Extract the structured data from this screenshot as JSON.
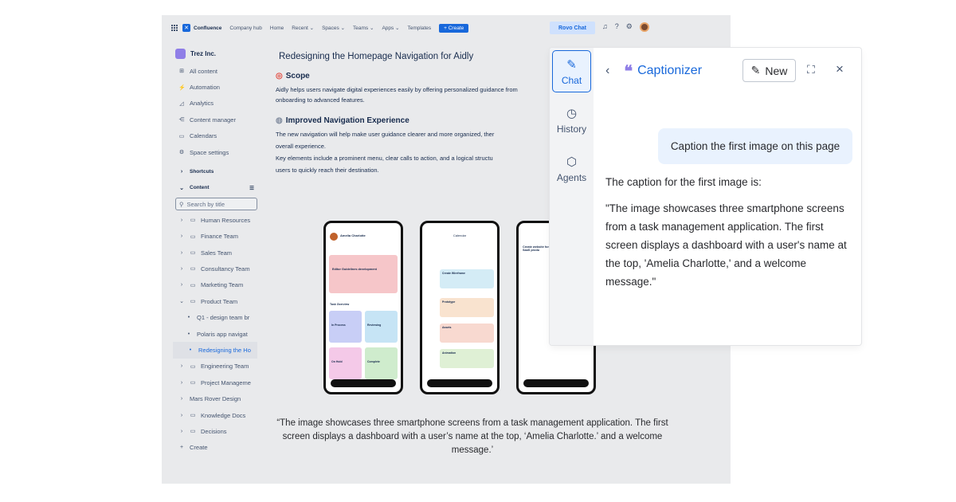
{
  "topbar": {
    "brand": "Confluence",
    "nav": [
      "Company hub",
      "Home",
      "Recent ⌄",
      "Spaces ⌄",
      "Teams ⌄",
      "Apps ⌄",
      "Templates"
    ],
    "create": "+ Create",
    "rovo_chat": "Rovo Chat"
  },
  "sidebar": {
    "space": "Trez Inc.",
    "items": [
      {
        "icon": "⊞",
        "label": "All content"
      },
      {
        "icon": "⚡",
        "label": "Automation"
      },
      {
        "icon": "◿",
        "label": "Analytics"
      },
      {
        "icon": "⋲",
        "label": "Content manager"
      },
      {
        "icon": "▭",
        "label": "Calendars"
      },
      {
        "icon": "⚙",
        "label": "Space settings"
      }
    ],
    "shortcuts": "Shortcuts",
    "content": "Content",
    "search_placeholder": "Search by title",
    "tree": [
      {
        "chev": "›",
        "icon": "▭",
        "label": "Human Resources",
        "indent": 0
      },
      {
        "chev": "›",
        "icon": "▭",
        "label": "Finance Team",
        "indent": 0
      },
      {
        "chev": "›",
        "icon": "▭",
        "label": "Sales Team",
        "indent": 0
      },
      {
        "chev": "›",
        "icon": "▭",
        "label": "Consultancy Team",
        "indent": 0
      },
      {
        "chev": "›",
        "icon": "▭",
        "label": "Marketing Team",
        "indent": 0
      },
      {
        "chev": "⌄",
        "icon": "▭",
        "label": "Product Team",
        "indent": 0
      },
      {
        "chev": "•",
        "icon": "",
        "label": "Q1 - design team br",
        "indent": 1
      },
      {
        "chev": "•",
        "icon": "",
        "label": "Polaris app navigat",
        "indent": 1
      },
      {
        "chev": "•",
        "icon": "",
        "label": "Redesigning the Ho",
        "indent": 1,
        "active": true
      },
      {
        "chev": "›",
        "icon": "▭",
        "label": "Engineering Team",
        "indent": 0
      },
      {
        "chev": "›",
        "icon": "▭",
        "label": "Project Manageme",
        "indent": 0
      },
      {
        "chev": "›",
        "icon": "",
        "label": "Mars Rover Design",
        "indent": 0
      },
      {
        "chev": "›",
        "icon": "▭",
        "label": "Knowledge Docs",
        "indent": 0
      },
      {
        "chev": "›",
        "icon": "▭",
        "label": "Decisions",
        "indent": 0
      },
      {
        "chev": "+",
        "icon": "",
        "label": "Create",
        "indent": 0
      }
    ]
  },
  "document": {
    "title": "Redesigning the Homepage Navigation for Aidly",
    "scope_heading": "Scope",
    "scope_text_1": "Aidly helps users navigate digital experiences easily by offering personalized guidance from",
    "scope_text_2": "onboarding to advanced features.",
    "nav_heading": "Improved Navigation Experience",
    "nav_text_1": "The new navigation will help make user guidance clearer and more organized, ther",
    "nav_text_2": "overall experience.",
    "nav_text_3": " Key elements include a prominent menu, clear calls to action, and a logical structu",
    "nav_text_4": "users to quickly reach their destination.",
    "caption": "“The image showcases three smartphone screens from a task management application. The first screen displays a dashboard with a user’s name at the top, ‘Amelia Charlotte.’ and a welcome message.’"
  },
  "phones": {
    "p1_name": "Amelia Charlotte",
    "p1_task": "Editor Guidelines development",
    "p1_overview": "Task Overview",
    "p1_labels": [
      "In Process",
      "Reviewing",
      "On Hold",
      "Complete"
    ],
    "p2_title": "Calendar",
    "p2_tasks": [
      "Create Wireframe",
      "Prototype",
      "Assets",
      "Animation"
    ],
    "p3_title": "Create website for SaaS produ"
  },
  "rovo": {
    "rail": [
      {
        "icon": "✎",
        "label": "Chat",
        "active": true
      },
      {
        "icon": "◷",
        "label": "History"
      },
      {
        "icon": "⬡",
        "label": "Agents"
      }
    ],
    "agent": "Captionizer",
    "new_label": "New",
    "user_message": "Caption the first image on this page",
    "reply_intro": "The caption for the first image is:",
    "reply_quote": "\"The image showcases three smartphone screens from a task management application. The first screen displays a dashboard with a user's name at the top, 'Amelia Charlotte,' and a welcome message.\""
  }
}
